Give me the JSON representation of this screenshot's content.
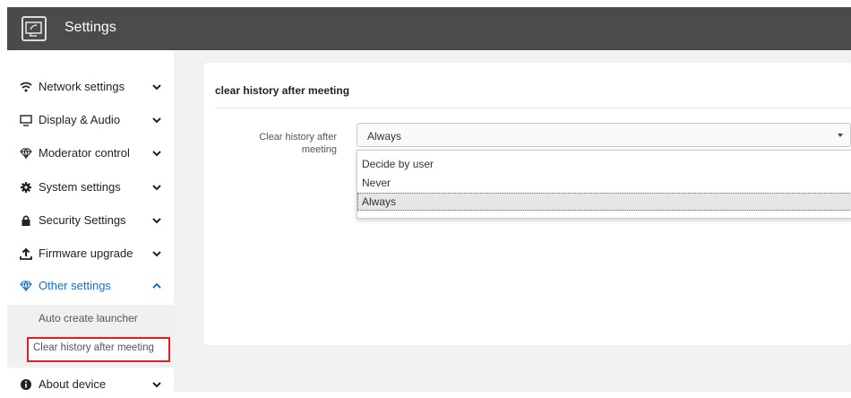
{
  "app": {
    "title": "Settings"
  },
  "sidebar": {
    "items": [
      {
        "label": "Network settings"
      },
      {
        "label": "Display & Audio"
      },
      {
        "label": "Moderator control"
      },
      {
        "label": "System settings"
      },
      {
        "label": "Security Settings"
      },
      {
        "label": "Firmware upgrade"
      },
      {
        "label": "Other settings"
      },
      {
        "label": "About device"
      }
    ],
    "sub_items": [
      {
        "label": "Auto create launcher"
      },
      {
        "label": "Clear history after meeting"
      }
    ]
  },
  "main": {
    "section_title": "clear history after meeting",
    "field_label": "Clear history after meeting",
    "select_value": "Always",
    "options": [
      "Decide by user",
      "Never",
      "Always"
    ]
  },
  "colors": {
    "accent": "#1f6fbf",
    "topbar": "#4b4b4b",
    "highlight": "#e02020"
  }
}
